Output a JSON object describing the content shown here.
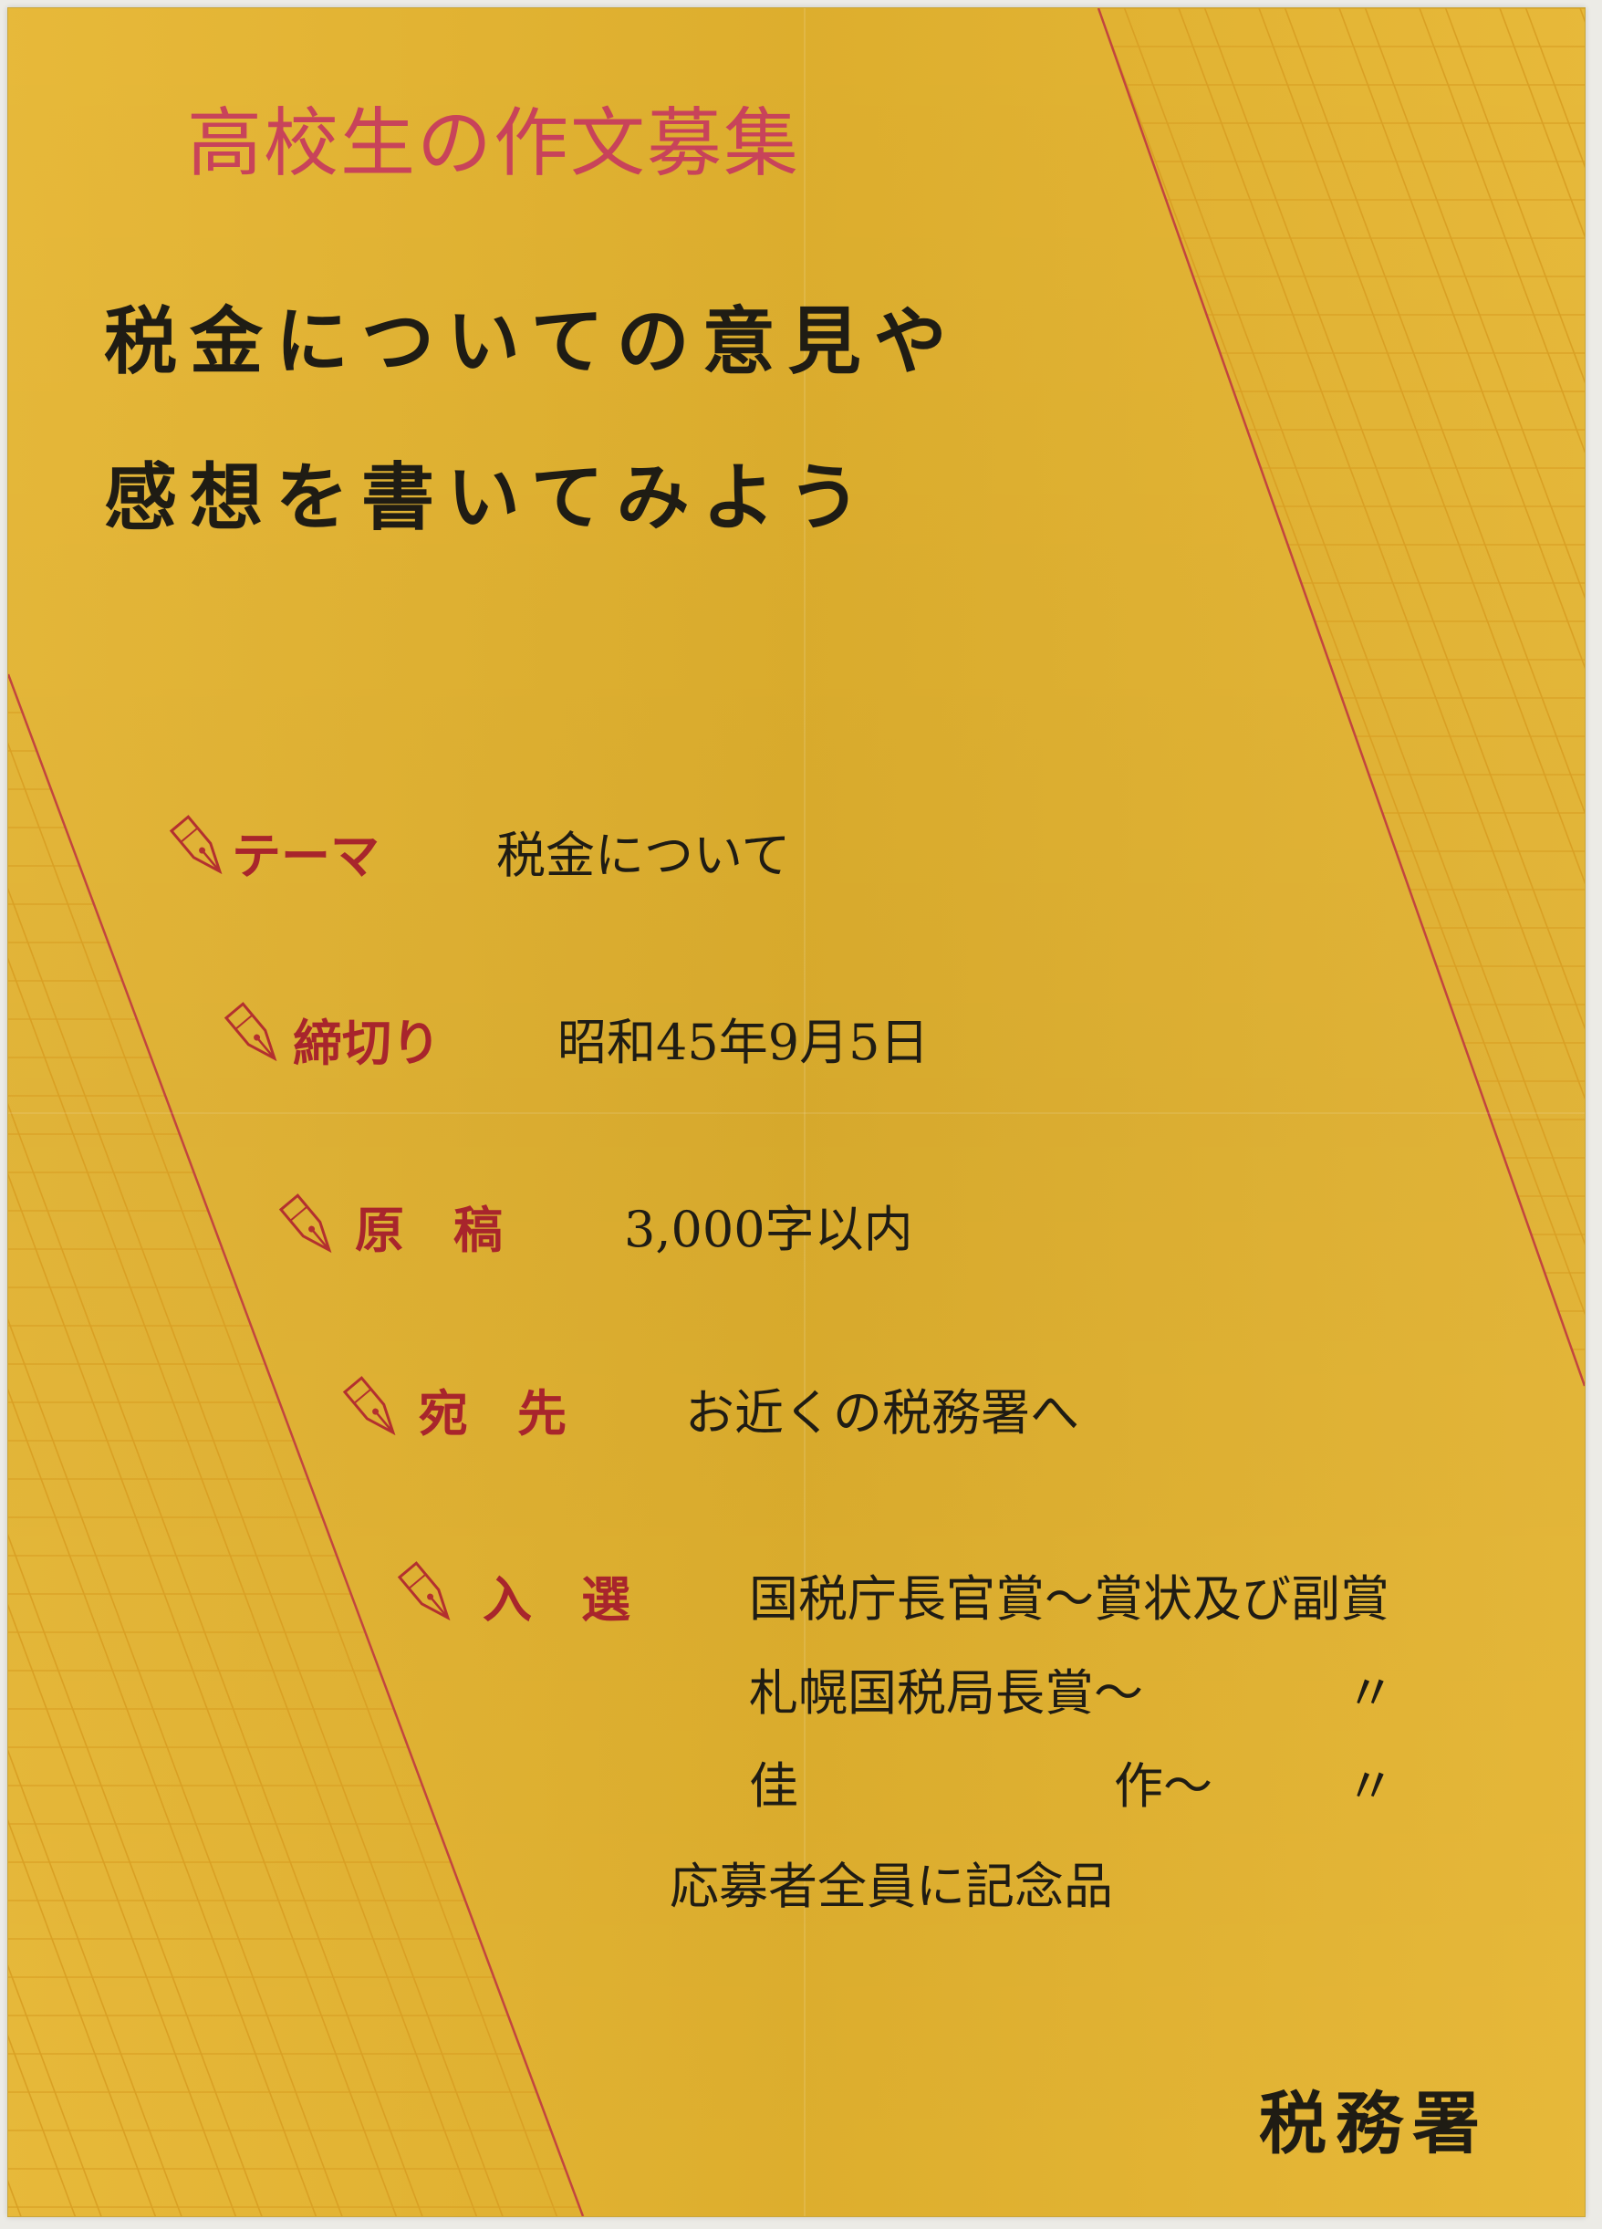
{
  "poster": {
    "heading": "高校生の作文募集",
    "subheading": {
      "line1": "税金についての意見や",
      "line2": "感想を書いてみよう"
    },
    "items": {
      "theme": {
        "label": "テーマ",
        "value": "税金について"
      },
      "deadline": {
        "label": "締切り",
        "value": "昭和45年9月5日"
      },
      "manuscript": {
        "label": "原　稿",
        "value": "3,000字以内"
      },
      "destination": {
        "label": "宛　先",
        "value": "お近くの税務署へ"
      },
      "selection": {
        "label": "入　選",
        "prize1": "国税庁長官賞～賞状及び副賞",
        "prize2_name": "札幌国税局長賞～",
        "prize2_ditto": "〃",
        "prize3_left": "佳",
        "prize3_right": "作～",
        "prize3_ditto": "〃"
      }
    },
    "note": "応募者全員に記念品",
    "organization": "税務署"
  },
  "colors": {
    "background": "#e6b52f",
    "heading": "#c8435a",
    "label": "#a8252c",
    "text": "#1f1c14",
    "grid_lines": "#d9a024"
  },
  "icons": {
    "bullet": "fountain-pen-nib-icon"
  }
}
